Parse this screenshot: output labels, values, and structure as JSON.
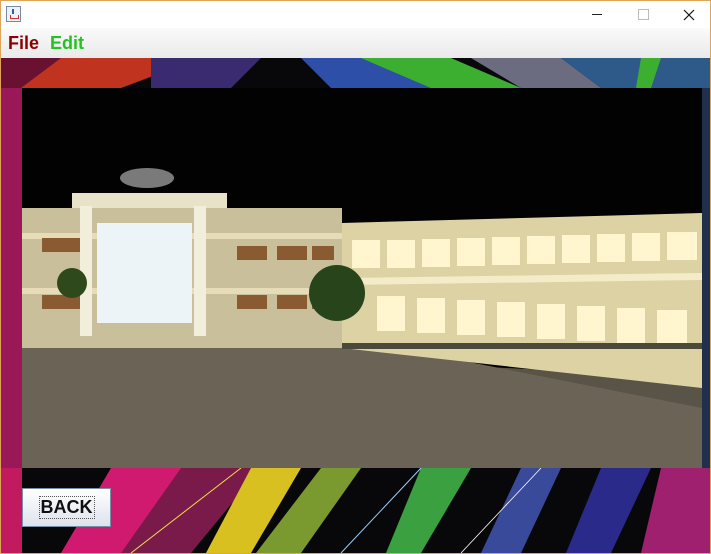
{
  "window": {
    "app_icon": "java-icon",
    "controls": {
      "minimize": "minimize-icon",
      "maximize": "maximize-icon",
      "close": "close-icon"
    }
  },
  "menu": {
    "file": {
      "label": "File",
      "color": "#8b0000"
    },
    "edit": {
      "label": "Edit",
      "color": "#22c322"
    }
  },
  "main": {
    "photo_description_icon": "campus-photo",
    "back_button": {
      "label": "BACK"
    }
  },
  "colors": {
    "window_border": "#e0a458",
    "content_background": "#07070a"
  }
}
